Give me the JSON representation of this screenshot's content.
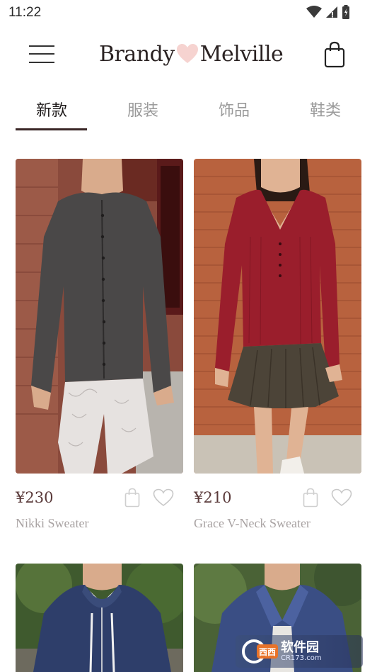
{
  "status_bar": {
    "time": "11:22",
    "icons": [
      "wifi-icon",
      "signal-icon",
      "battery-icon"
    ]
  },
  "header": {
    "brand_left": "Brandy",
    "brand_right": "Melville",
    "heart_color": "#f6d3d0",
    "icons": [
      "menu-icon",
      "shopping-bag-icon"
    ]
  },
  "tabs": [
    {
      "label": "新款",
      "active": true
    },
    {
      "label": "服装",
      "active": false
    },
    {
      "label": "饰品",
      "active": false
    },
    {
      "label": "鞋类",
      "active": false
    }
  ],
  "products": [
    {
      "name": "Nikki Sweater",
      "price": "¥230",
      "image": "grey cardigan with lace pants"
    },
    {
      "name": "Grace V-Neck Sweater",
      "price": "¥210",
      "image": "red v-neck sweater with pleated skirt"
    },
    {
      "name": "",
      "price": "",
      "image": "navy zip hoodie"
    },
    {
      "name": "",
      "price": "",
      "image": "navy zip jacket"
    }
  ],
  "watermark": {
    "logo_text": "西西",
    "title": "软件园",
    "subtitle": "CR173.com"
  },
  "colors": {
    "accent": "#3a2626",
    "price": "#5a3a3a",
    "muted_text": "#a9a3a3",
    "tab_inactive": "#9a9a9a"
  }
}
